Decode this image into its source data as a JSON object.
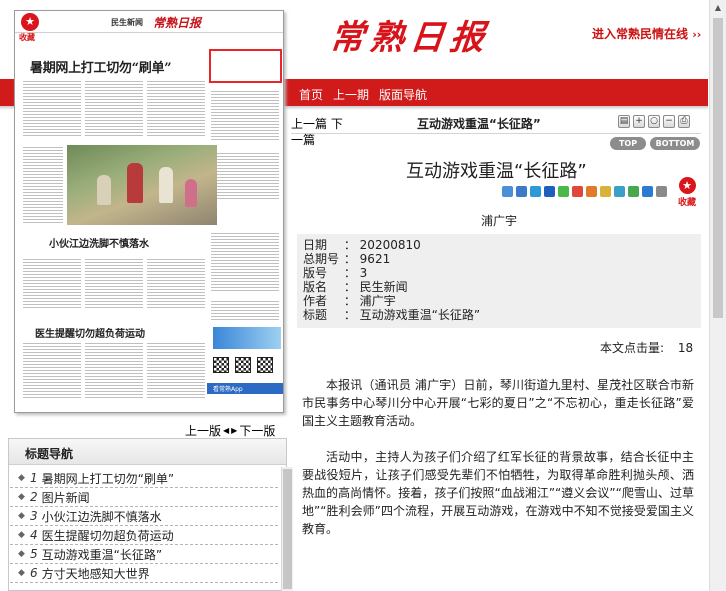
{
  "masthead": {
    "logo_chars": [
      "常",
      "熟",
      "日",
      "报"
    ],
    "link_label": "进入常熟民情在线",
    "link_arrows": "››"
  },
  "nav": {
    "items": [
      "首页",
      "上一期",
      "版面导航"
    ]
  },
  "thumbnail": {
    "collect_label": "收藏",
    "section": "民生新闻",
    "paper_name": "常熟日报",
    "headline_1": "暑期网上打工切勿“刷单”",
    "headline_2": "小伙江边洗脚不慎落水",
    "headline_3": "医生提醒切勿超负荷运动",
    "app_label": "看常熟App"
  },
  "pager": {
    "prev_page": "上一版",
    "next_page": "下一版"
  },
  "title_nav": {
    "heading": "标题导航",
    "items": [
      {
        "num": "1",
        "text": "暑期网上打工切勿“刷单”"
      },
      {
        "num": "2",
        "text": "图片新闻"
      },
      {
        "num": "3",
        "text": "小伙江边洗脚不慎落水"
      },
      {
        "num": "4",
        "text": "医生提醒切勿超负荷运动"
      },
      {
        "num": "5",
        "text": "互动游戏重温“长征路”"
      },
      {
        "num": "6",
        "text": "方寸天地感知大世界"
      }
    ]
  },
  "article_bar": {
    "prev": "上一篇",
    "next": "下",
    "next_cont": "一篇",
    "title": "互动游戏重温“长征路”",
    "top_label": "TOP",
    "bottom_label": "BOTTOM"
  },
  "article": {
    "title": "互动游戏重温“长征路”",
    "collect_label": "收藏",
    "author": "浦广宇",
    "meta": [
      {
        "label": "日期",
        "value": "20200810"
      },
      {
        "label": "总期号",
        "value": "9621"
      },
      {
        "label": "版号",
        "value": "3"
      },
      {
        "label": "版名",
        "value": "民生新闻"
      },
      {
        "label": "作者",
        "value": "浦广宇"
      },
      {
        "label": "标题",
        "value": "互动游戏重温“长征路”"
      }
    ],
    "hits_label": "本文点击量:",
    "hits_value": "18",
    "paragraphs": [
      "本报讯（通讯员 浦广宇）日前，琴川街道九里村、星茂社区联合市新市民事务中心琴川分中心开展“七彩的夏日”之“不忘初心，重走长征路”爱国主义主题教育活动。",
      "活动中，主持人为孩子们介绍了红军长征的背景故事，结合长征中主要战役短片，让孩子们感受先辈们不怕牺牲，为取得革命胜利抛头颅、洒热血的高尚情怀。接着，孩子们按照“血战湘江”“遵义会议”“爬雪山、过草地”“胜利会师”四个流程，开展互动游戏，在游戏中不知不觉接受爱国主义教育。"
    ]
  },
  "colors": {
    "brand_red": "#d11b1b",
    "logo_red": "#d8141a",
    "meta_bg": "#efefef"
  },
  "icons": {
    "share": [
      "share-plus-icon",
      "share-qq-icon",
      "share-space-icon",
      "share-renren-icon",
      "share-wechat-icon",
      "share-weibo-icon",
      "share-douban-icon",
      "share-kaixin-icon",
      "share-sohu-icon",
      "share-tieba-icon",
      "share-netease-icon",
      "share-more-icon"
    ],
    "tools": [
      "print-preview-icon",
      "zoom-in-icon",
      "zoom-reset-icon",
      "zoom-out-icon",
      "print-icon"
    ]
  }
}
